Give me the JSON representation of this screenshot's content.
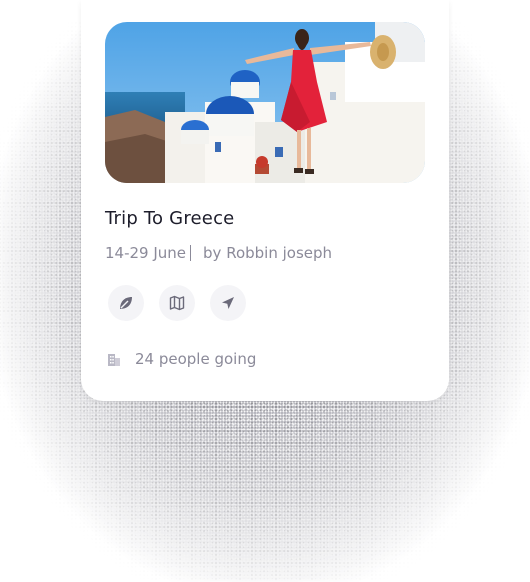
{
  "card": {
    "image_icon": "santorini-photo",
    "title": "Trip To Greece",
    "dates": "14-29 June",
    "author": "by Robbin joseph",
    "actions": [
      {
        "icon": "leaf-icon"
      },
      {
        "icon": "map-icon"
      },
      {
        "icon": "send-icon"
      }
    ],
    "going_icon": "building-icon",
    "going_text": "24 people going"
  },
  "colors": {
    "title": "#1d1d2b",
    "muted": "#8b8a99",
    "button_bg": "#f4f4f7"
  }
}
